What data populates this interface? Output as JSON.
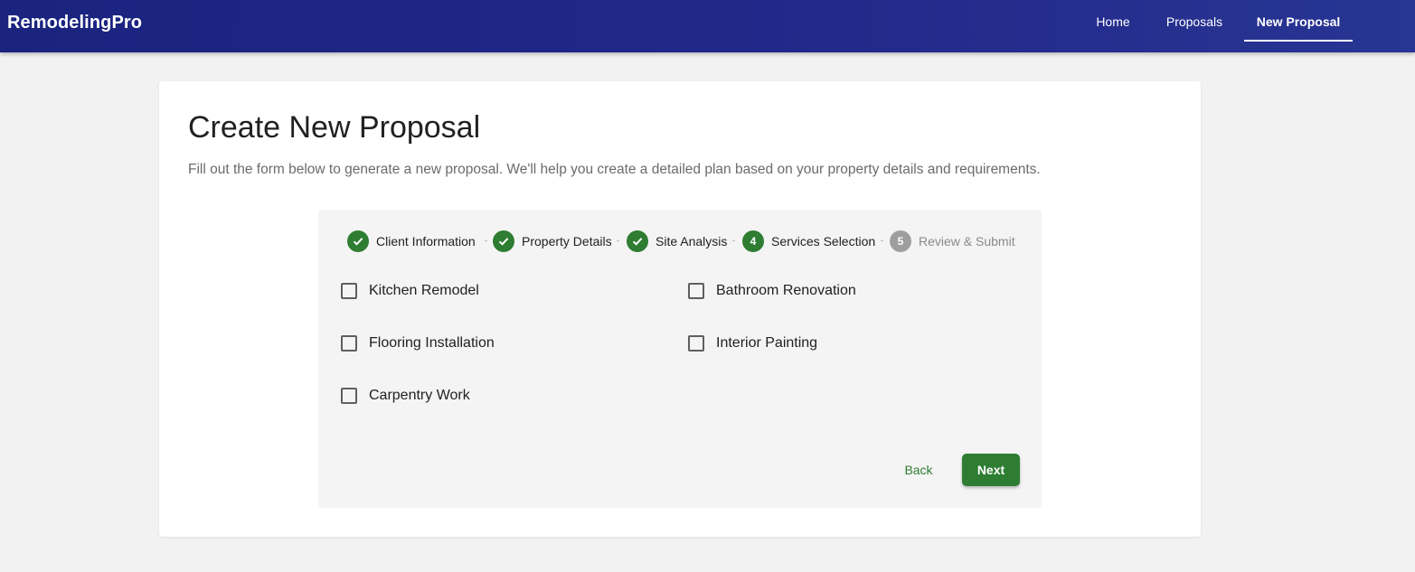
{
  "app": {
    "brand": "RemodelingPro"
  },
  "nav": {
    "items": [
      {
        "label": "Home"
      },
      {
        "label": "Proposals"
      },
      {
        "label": "New Proposal",
        "active": true
      }
    ]
  },
  "page": {
    "title": "Create New Proposal",
    "subtitle": "Fill out the form below to generate a new proposal. We'll help you create a detailed plan based on your property details and requirements."
  },
  "stepper": {
    "steps": [
      {
        "label": "Client Information",
        "status": "completed",
        "icon": "check-icon"
      },
      {
        "label": "Property Details",
        "status": "completed",
        "icon": "check-icon"
      },
      {
        "label": "Site Analysis",
        "status": "completed",
        "icon": "check-icon"
      },
      {
        "number": "4",
        "label": "Services Selection",
        "status": "active"
      },
      {
        "number": "5",
        "label": "Review & Submit",
        "status": "pending"
      }
    ]
  },
  "services": {
    "options": [
      {
        "label": "Kitchen Remodel",
        "checked": false
      },
      {
        "label": "Bathroom Renovation",
        "checked": false
      },
      {
        "label": "Flooring Installation",
        "checked": false
      },
      {
        "label": "Interior Painting",
        "checked": false
      },
      {
        "label": "Carpentry Work",
        "checked": false
      }
    ]
  },
  "actions": {
    "back_label": "Back",
    "next_label": "Next"
  },
  "colors": {
    "appbar": "#1a237e",
    "accent_green": "#2e7d32",
    "pending_grey": "#9e9e9e",
    "background": "#f2f2f2"
  }
}
